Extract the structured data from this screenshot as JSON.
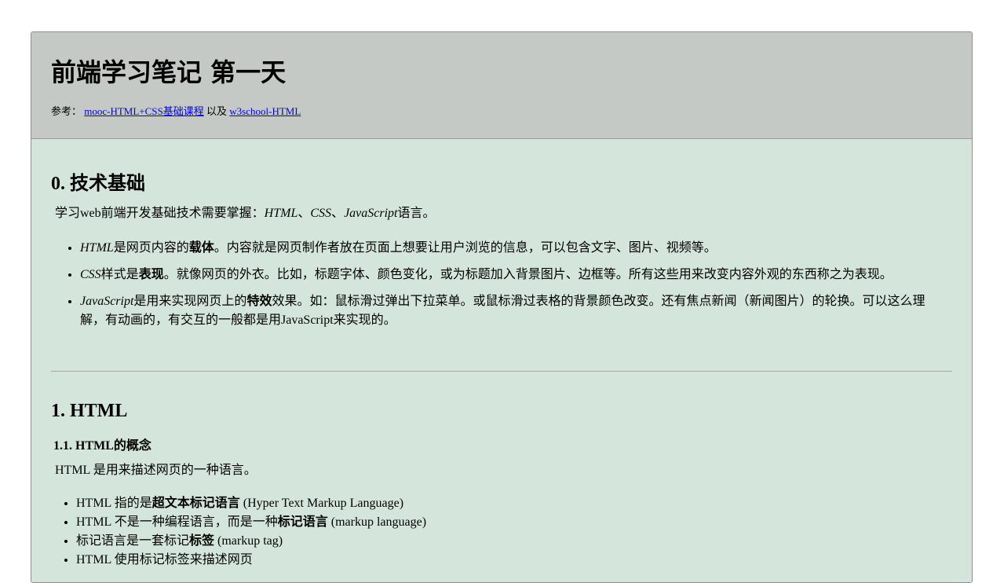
{
  "header": {
    "title": "前端学习笔记 第一天",
    "ref_prefix": "参考：",
    "link1": "mooc-HTML+CSS基础课程",
    "ref_mid": "以及",
    "link2": "w3school-HTML"
  },
  "section0": {
    "heading": "0. 技术基础",
    "intro_a": "学习web前端开发基础技术需要掌握：",
    "intro_html": "HTML",
    "intro_sep1": "、",
    "intro_css": "CSS",
    "intro_sep2": "、",
    "intro_js": "JavaScript",
    "intro_end": "语言。",
    "items": [
      {
        "term": "HTML",
        "a": "是网页内容的",
        "bold": "载体",
        "b": "。内容就是网页制作者放在页面上想要让用户浏览的信息，可以包含文字、图片、视频等。"
      },
      {
        "term": "CSS",
        "a": "样式是",
        "bold": "表现",
        "b": "。就像网页的外衣。比如，标题字体、颜色变化，或为标题加入背景图片、边框等。所有这些用来改变内容外观的东西称之为表现。"
      },
      {
        "term": "JavaScript",
        "a": "是用来实现网页上的",
        "bold": "特效",
        "b": "效果。如：鼠标滑过弹出下拉菜单。或鼠标滑过表格的背景颜色改变。还有焦点新闻（新闻图片）的轮换。可以这么理解，有动画的，有交互的一般都是用JavaScript来实现的。"
      }
    ]
  },
  "section1": {
    "heading": "1. HTML",
    "sub_heading": "1.1. HTML的概念",
    "intro": "HTML 是用来描述网页的一种语言。",
    "items": [
      {
        "a": "HTML 指的是",
        "bold": "超文本标记语言",
        "b": " (Hyper Text Markup Language)"
      },
      {
        "a": "HTML 不是一种编程语言，而是一种",
        "bold": "标记语言",
        "b": " (markup language)"
      },
      {
        "a": "标记语言是一套标记",
        "bold": "标签",
        "b": " (markup tag)"
      },
      {
        "a": "HTML 使用标记标签来描述网页",
        "bold": "",
        "b": ""
      }
    ]
  }
}
